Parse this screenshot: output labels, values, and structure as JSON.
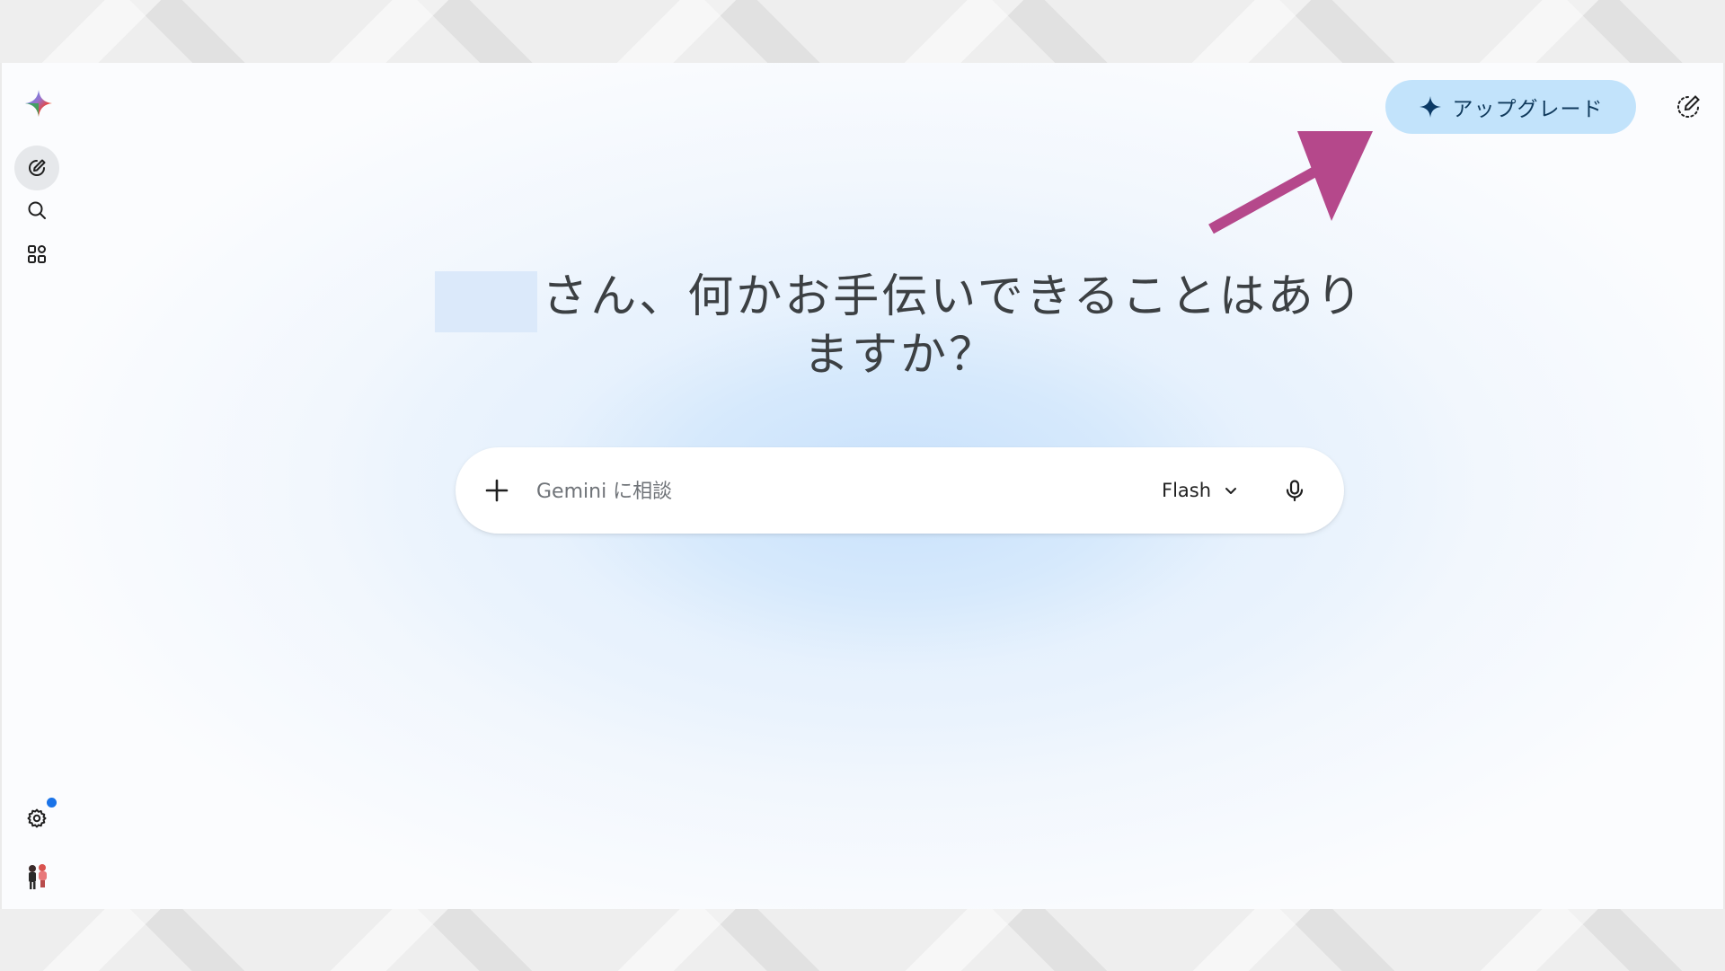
{
  "header": {
    "upgrade_label": "アップグレード"
  },
  "greeting": {
    "line1": "さん、何かお手伝いできることはあり",
    "line2": "ますか？"
  },
  "prompt": {
    "placeholder": "Gemini に相談",
    "model": "Flash"
  },
  "icons": {
    "logo": "gemini-spark-icon",
    "new_chat": "edit-icon",
    "search": "search-icon",
    "apps": "apps-grid-icon",
    "settings": "gear-icon",
    "avatar": "avatar-icon",
    "upgrade": "spark-star-icon",
    "compose": "temporary-chat-icon",
    "add": "plus-icon",
    "dropdown": "chevron-down-icon",
    "mic": "microphone-icon"
  },
  "colors": {
    "upgrade_bg": "#c2e3fb",
    "upgrade_text": "#103a5c",
    "annotation_arrow": "#b5488b",
    "notification_dot": "#1a73e8"
  }
}
